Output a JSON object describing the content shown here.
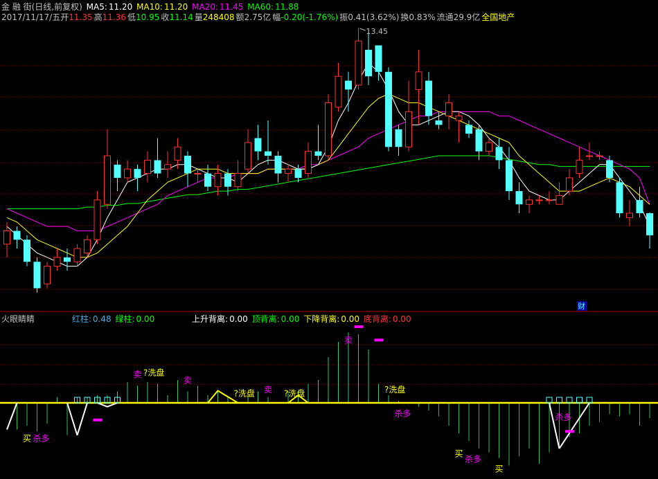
{
  "header": {
    "title": "金 融 街(日线,前复权)",
    "ma5_label": "MA5:",
    "ma5_value": "11.20",
    "ma10_label": "MA10:",
    "ma10_value": "11.20",
    "ma20_label": "MA20:",
    "ma20_value": "11.45",
    "ma60_label": "MA60:",
    "ma60_value": "11.88"
  },
  "quote": {
    "date": "2017/11/17/五",
    "open_label": "开",
    "open": "11.35",
    "high_label": "高",
    "high": "11.36",
    "low_label": "低",
    "low": "10.95",
    "close_label": "收",
    "close": "11.14",
    "vol_label": "量",
    "vol": "248408",
    "amount_label": "额",
    "amount": "2.75亿",
    "change_label": "幅",
    "change": "-0.20(-1.76%)",
    "amp_label": "振",
    "amp": "0.41(3.62%)",
    "turnover_label": "换",
    "turnover": "0.83%",
    "float_label": "流通",
    "float": "29.9亿",
    "sector": "全国地产"
  },
  "indicator": {
    "name": "火眼睛睛",
    "red_label": "红柱:",
    "red_value": "0.48",
    "green_label": "绿柱:",
    "green_value": "0.00",
    "up_div_label": "上升背离:",
    "up_div_value": "0.00",
    "top_div_label": "顶背离:",
    "top_div_value": "0.00",
    "down_div_label": "下降背离:",
    "down_div_value": "0.00",
    "bottom_div_label": "底背离:",
    "bottom_div_value": "0.00"
  },
  "colors": {
    "up": "#ff3232",
    "down": "#54ffff",
    "ma5": "#ffffff",
    "ma10": "#ffff00",
    "ma20": "#ff00ff",
    "ma60": "#00ff00",
    "grid": "#800000",
    "signal": "#ffff00",
    "buy": "#ffff00",
    "sell": "#ff00ff",
    "wash": "#ffff00"
  },
  "chart_data": {
    "type": "candlestick",
    "max_label": "13.45",
    "caption_cai": "财",
    "candles": [
      [
        11.0,
        11.15,
        11.25,
        10.85
      ],
      [
        11.15,
        11.05,
        11.2,
        10.95
      ],
      [
        11.05,
        10.8,
        11.1,
        10.75
      ],
      [
        10.8,
        10.5,
        10.85,
        10.45
      ],
      [
        10.55,
        10.75,
        10.8,
        10.5
      ],
      [
        10.75,
        10.85,
        10.95,
        10.7
      ],
      [
        10.85,
        10.8,
        10.95,
        10.7
      ],
      [
        10.8,
        10.95,
        11.0,
        10.75
      ],
      [
        10.9,
        11.05,
        11.1,
        10.85
      ],
      [
        11.05,
        11.5,
        11.6,
        11.0
      ],
      [
        11.45,
        12.0,
        12.3,
        11.4
      ],
      [
        11.9,
        11.75,
        11.95,
        11.6
      ],
      [
        11.75,
        11.85,
        11.95,
        11.7
      ],
      [
        11.85,
        11.75,
        11.9,
        11.6
      ],
      [
        11.8,
        11.95,
        12.05,
        11.7
      ],
      [
        11.95,
        11.8,
        12.2,
        11.75
      ],
      [
        11.85,
        11.9,
        12.05,
        11.75
      ],
      [
        11.95,
        12.1,
        12.2,
        11.85
      ],
      [
        12.0,
        11.8,
        12.05,
        11.65
      ],
      [
        11.8,
        11.8,
        11.85,
        11.7
      ],
      [
        11.8,
        11.65,
        11.9,
        11.6
      ],
      [
        11.65,
        11.8,
        11.9,
        11.55
      ],
      [
        11.8,
        11.65,
        11.85,
        11.55
      ],
      [
        11.65,
        11.8,
        11.95,
        11.6
      ],
      [
        11.85,
        12.15,
        12.3,
        11.8
      ],
      [
        12.2,
        12.05,
        12.35,
        11.95
      ],
      [
        12.05,
        12.0,
        12.4,
        11.9
      ],
      [
        12.0,
        11.8,
        12.05,
        11.7
      ],
      [
        11.8,
        11.85,
        11.9,
        11.7
      ],
      [
        11.85,
        11.75,
        11.9,
        11.7
      ],
      [
        11.8,
        12.05,
        12.15,
        11.75
      ],
      [
        12.05,
        12.0,
        12.35,
        11.95
      ],
      [
        12.0,
        12.6,
        12.7,
        11.95
      ],
      [
        12.55,
        12.9,
        13.05,
        12.5
      ],
      [
        12.85,
        12.75,
        12.95,
        12.5
      ],
      [
        12.8,
        13.3,
        13.45,
        12.75
      ],
      [
        13.2,
        12.9,
        13.4,
        12.8
      ],
      [
        13.25,
        12.95,
        13.15,
        12.85
      ],
      [
        12.95,
        12.1,
        13.0,
        12.05
      ],
      [
        12.3,
        12.1,
        12.35,
        12.0
      ],
      [
        12.1,
        12.5,
        12.85,
        12.05
      ],
      [
        12.75,
        12.95,
        13.2,
        12.35
      ],
      [
        12.85,
        12.45,
        12.95,
        12.35
      ],
      [
        12.4,
        12.35,
        12.5,
        12.3
      ],
      [
        12.45,
        12.6,
        12.7,
        12.3
      ],
      [
        12.4,
        12.45,
        12.5,
        12.15
      ],
      [
        12.35,
        12.25,
        12.4,
        12.2
      ],
      [
        12.3,
        12.05,
        12.35,
        11.95
      ],
      [
        12.05,
        12.15,
        12.2,
        12.0
      ],
      [
        12.1,
        11.95,
        12.2,
        11.85
      ],
      [
        11.95,
        11.6,
        12.1,
        11.5
      ],
      [
        11.6,
        11.45,
        11.7,
        11.35
      ],
      [
        11.45,
        11.5,
        11.55,
        11.35
      ],
      [
        11.5,
        11.5,
        11.55,
        11.45
      ],
      [
        11.5,
        11.5,
        11.6,
        11.45
      ],
      [
        11.45,
        11.55,
        11.7,
        11.45
      ],
      [
        11.6,
        11.75,
        11.85,
        11.55
      ],
      [
        11.8,
        11.95,
        12.1,
        11.75
      ],
      [
        12.0,
        12.0,
        12.15,
        11.95
      ],
      [
        12.0,
        12.0,
        12.05,
        11.95
      ],
      [
        11.95,
        11.75,
        12.0,
        11.7
      ],
      [
        11.7,
        11.35,
        11.75,
        11.3
      ],
      [
        11.3,
        11.35,
        11.5,
        11.2
      ],
      [
        11.5,
        11.35,
        11.65,
        11.3
      ],
      [
        11.35,
        11.1,
        11.36,
        10.95
      ]
    ],
    "ma5": [
      11.2,
      11.1,
      11.0,
      10.9,
      10.85,
      10.8,
      10.75,
      10.75,
      10.85,
      11.05,
      11.3,
      11.5,
      11.7,
      11.75,
      11.8,
      11.85,
      11.85,
      11.9,
      11.9,
      11.85,
      11.8,
      11.75,
      11.75,
      11.7,
      11.8,
      11.9,
      11.95,
      11.95,
      11.9,
      11.85,
      11.85,
      11.9,
      12.1,
      12.4,
      12.6,
      12.85,
      13.05,
      12.95,
      12.75,
      12.5,
      12.35,
      12.35,
      12.4,
      12.45,
      12.5,
      12.5,
      12.45,
      12.35,
      12.2,
      12.1,
      11.95,
      11.75,
      11.6,
      11.55,
      11.5,
      11.5,
      11.6,
      11.7,
      11.8,
      11.9,
      11.9,
      11.75,
      11.6,
      11.45,
      11.2
    ],
    "ma10": [
      11.3,
      11.25,
      11.15,
      11.05,
      11.0,
      10.95,
      10.9,
      10.85,
      10.85,
      10.9,
      11.0,
      11.1,
      11.2,
      11.35,
      11.5,
      11.6,
      11.7,
      11.75,
      11.8,
      11.85,
      11.85,
      11.85,
      11.8,
      11.8,
      11.8,
      11.8,
      11.85,
      11.85,
      11.85,
      11.85,
      11.85,
      11.9,
      11.95,
      12.1,
      12.25,
      12.4,
      12.55,
      12.65,
      12.7,
      12.65,
      12.6,
      12.6,
      12.55,
      12.5,
      12.45,
      12.4,
      12.35,
      12.3,
      12.25,
      12.2,
      12.15,
      12.0,
      11.9,
      11.8,
      11.7,
      11.6,
      11.6,
      11.6,
      11.65,
      11.7,
      11.75,
      11.7,
      11.65,
      11.55,
      11.45
    ],
    "ma20": [
      11.4,
      11.35,
      11.3,
      11.25,
      11.2,
      11.2,
      11.2,
      11.15,
      11.15,
      11.15,
      11.2,
      11.25,
      11.3,
      11.35,
      11.4,
      11.45,
      11.55,
      11.6,
      11.65,
      11.7,
      11.75,
      11.75,
      11.75,
      11.8,
      11.8,
      11.8,
      11.85,
      11.85,
      11.85,
      11.85,
      11.9,
      11.9,
      11.95,
      12.0,
      12.05,
      12.1,
      12.2,
      12.25,
      12.3,
      12.35,
      12.4,
      12.45,
      12.45,
      12.5,
      12.5,
      12.5,
      12.5,
      12.5,
      12.5,
      12.45,
      12.45,
      12.4,
      12.35,
      12.3,
      12.25,
      12.2,
      12.15,
      12.1,
      12.05,
      12.0,
      11.95,
      11.9,
      11.85,
      11.75,
      11.45
    ],
    "ma60": [
      11.4,
      11.4,
      11.4,
      11.4,
      11.4,
      11.4,
      11.4,
      11.4,
      11.42,
      11.42,
      11.44,
      11.44,
      11.46,
      11.46,
      11.48,
      11.5,
      11.52,
      11.54,
      11.56,
      11.56,
      11.58,
      11.6,
      11.6,
      11.62,
      11.62,
      11.64,
      11.66,
      11.68,
      11.7,
      11.72,
      11.74,
      11.76,
      11.78,
      11.8,
      11.82,
      11.84,
      11.86,
      11.88,
      11.9,
      11.92,
      11.94,
      11.96,
      11.98,
      12.0,
      12.0,
      12.0,
      12.0,
      12.0,
      12.0,
      11.98,
      11.96,
      11.94,
      11.92,
      11.9,
      11.9,
      11.88,
      11.88,
      11.88,
      11.88,
      11.88,
      11.88,
      11.88,
      11.88,
      11.88,
      11.88
    ],
    "indicator_bars": [
      0,
      -0.7,
      -0.6,
      -0.75,
      -0.55,
      0.15,
      -0.85,
      0.15,
      0.15,
      0.2,
      0.2,
      0.3,
      0.55,
      0.45,
      0.55,
      0.5,
      0.2,
      0.6,
      0.3,
      0.45,
      0.2,
      0.3,
      0.15,
      0,
      0.2,
      0.3,
      0.15,
      0,
      0.3,
      0.3,
      0.5,
      0.6,
      1.2,
      1.6,
      1.85,
      1.8,
      1.4,
      0.5,
      0.2,
      0.05,
      0,
      -0.1,
      -0.2,
      -0.35,
      -0.6,
      -0.8,
      -1.0,
      -1.2,
      -1.3,
      -1.45,
      -1.65,
      -1.4,
      -1.2,
      -1.6,
      -1.3,
      -1.2,
      -0.9,
      -0.8,
      -0.6,
      -0.5,
      -0.3,
      -0.35,
      -0.3,
      -0.6,
      -0.4
    ],
    "markers": [
      {
        "text": "买",
        "i": 2,
        "v": -0.75,
        "kind": "buy"
      },
      {
        "text": "杀多",
        "i": 3,
        "v": -0.75,
        "kind": "sell"
      },
      {
        "text": "卖",
        "i": 13,
        "v": 0.6,
        "kind": "sell"
      },
      {
        "text": "?洗盘",
        "i": 14,
        "v": 0.65,
        "kind": "wash"
      },
      {
        "text": "卖",
        "i": 18,
        "v": 0.45,
        "kind": "sell"
      },
      {
        "text": "?洗盘",
        "i": 23,
        "v": 0.1,
        "kind": "wash"
      },
      {
        "text": "卖",
        "i": 26,
        "v": 0.2,
        "kind": "sell"
      },
      {
        "text": "?洗盘",
        "i": 28,
        "v": 0.1,
        "kind": "wash"
      },
      {
        "text": "卖",
        "i": 34,
        "v": 1.5,
        "kind": "sell"
      },
      {
        "text": "?洗盘",
        "i": 38,
        "v": 0.2,
        "kind": "wash"
      },
      {
        "text": "杀多",
        "i": 39,
        "v": -0.1,
        "kind": "sell"
      },
      {
        "text": "买",
        "i": 45,
        "v": -1.15,
        "kind": "buy"
      },
      {
        "text": "杀多",
        "i": 46,
        "v": -1.3,
        "kind": "sell"
      },
      {
        "text": "买",
        "i": 49,
        "v": -1.55,
        "kind": "buy"
      },
      {
        "text": "杀多",
        "i": 55,
        "v": -0.2,
        "kind": "sell"
      }
    ]
  }
}
